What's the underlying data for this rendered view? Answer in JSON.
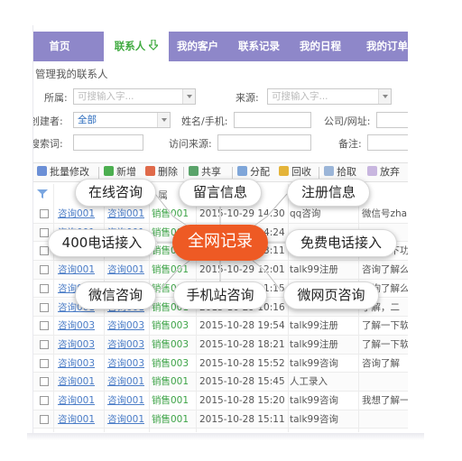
{
  "nav": {
    "items": [
      "首页",
      "联系人",
      "我的客户",
      "联系记录",
      "我的日程",
      "我的订单"
    ],
    "active_index": 1
  },
  "section_title": "管理我的联系人",
  "filters": {
    "owner_label": "所属:",
    "owner_placeholder": "可搜输入字...",
    "source_label": "来源:",
    "source_placeholder": "可搜输入字...",
    "creator_label": "创建者:",
    "creator_value": "全部",
    "name_label": "姓名/手机:",
    "company_label": "公司/网址:",
    "keyword_label": "搜索词:",
    "visit_label": "访问来源:",
    "remark_label": "备注:"
  },
  "toolbar": {
    "batch_edit": "批量修改",
    "add": "新增",
    "delete": "删除",
    "share": "共享",
    "assign": "分配",
    "recycle": "回收",
    "pick": "拾取",
    "abandon": "放弃"
  },
  "table": {
    "header_partial": [
      "属",
      "间"
    ],
    "rows": [
      {
        "c1": "咨询001",
        "c2": "咨询001",
        "c3": "销售001",
        "time": "2015-10-29 14:30",
        "src": "qq咨询",
        "note": "微信号zha"
      },
      {
        "c1": "咨询001",
        "c2": "咨询001",
        "c3": "销售001",
        "time": "2015-10-29 14:24",
        "src": "",
        "note": ""
      },
      {
        "c1": "咨询001",
        "c2": "咨询001",
        "c3": "销售001",
        "time": "2015-10-29 13:11",
        "src": "",
        "note": "了解一下功"
      },
      {
        "c1": "咨询001",
        "c2": "咨询001",
        "c3": "销售001",
        "time": "2015-10-29 12:01",
        "src": "talk99注册",
        "note": "咨询了解么"
      },
      {
        "c1": "咨询001",
        "c2": "咨询001",
        "c3": "销售001",
        "time": "2015-10-29 11:15",
        "src": "talk99注册",
        "note": "咨询了解么"
      },
      {
        "c1": "咨询001",
        "c2": "咨询001",
        "c3": "销售001",
        "time": "2015-10-29 10:16",
        "src": "",
        "note": "了解，二"
      },
      {
        "c1": "咨询003",
        "c2": "咨询003",
        "c3": "销售003",
        "time": "2015-10-28 19:54",
        "src": "talk99注册",
        "note": "了解一下软"
      },
      {
        "c1": "咨询003",
        "c2": "咨询003",
        "c3": "销售003",
        "time": "2015-10-28 18:21",
        "src": "talk99注册",
        "note": "了解一下软"
      },
      {
        "c1": "咨询003",
        "c2": "咨询003",
        "c3": "销售003",
        "time": "2015-10-28 15:52",
        "src": "talk99咨询",
        "note": "咨询了解"
      },
      {
        "c1": "咨询001",
        "c2": "咨询001",
        "c3": "销售001",
        "time": "2015-10-28 15:45",
        "src": "人工录入",
        "note": ""
      },
      {
        "c1": "咨询001",
        "c2": "咨询001",
        "c3": "销售001",
        "time": "2015-10-28 15:20",
        "src": "talk99咨询",
        "note": "我想了解一"
      },
      {
        "c1": "咨询001",
        "c2": "咨询001",
        "c3": "销售001",
        "time": "2015-10-28 15:11",
        "src": "talk99咨询",
        "note": ""
      }
    ]
  },
  "overlay": {
    "center": "全网记录",
    "online_consult": "在线咨询",
    "message_info": "留言信息",
    "register_info": "注册信息",
    "phone_400": "400电话接入",
    "free_phone": "免费电话接入",
    "wechat_consult": "微信咨询",
    "mobile_consult": "手机站咨询",
    "microsite_consult": "微网页咨询",
    "accent_color": "#ee5a24"
  }
}
